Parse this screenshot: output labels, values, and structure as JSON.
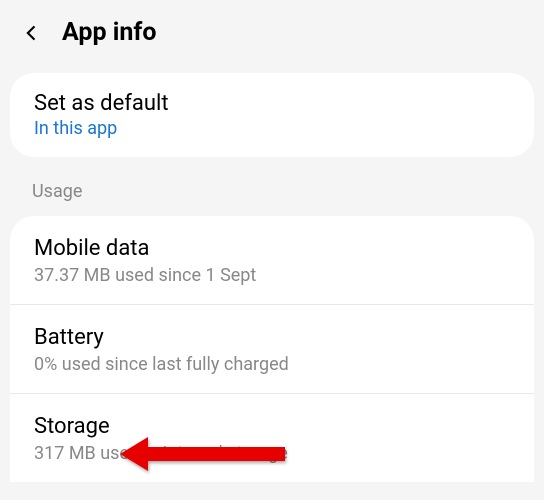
{
  "header": {
    "title": "App info"
  },
  "default_card": {
    "title": "Set as default",
    "link": "In this app"
  },
  "section_header": "Usage",
  "usage": {
    "items": [
      {
        "title": "Mobile data",
        "sub": "37.37 MB used since 1 Sept"
      },
      {
        "title": "Battery",
        "sub": "0% used since last fully charged"
      },
      {
        "title": "Storage",
        "sub": "317 MB used in Internal storage"
      }
    ]
  }
}
